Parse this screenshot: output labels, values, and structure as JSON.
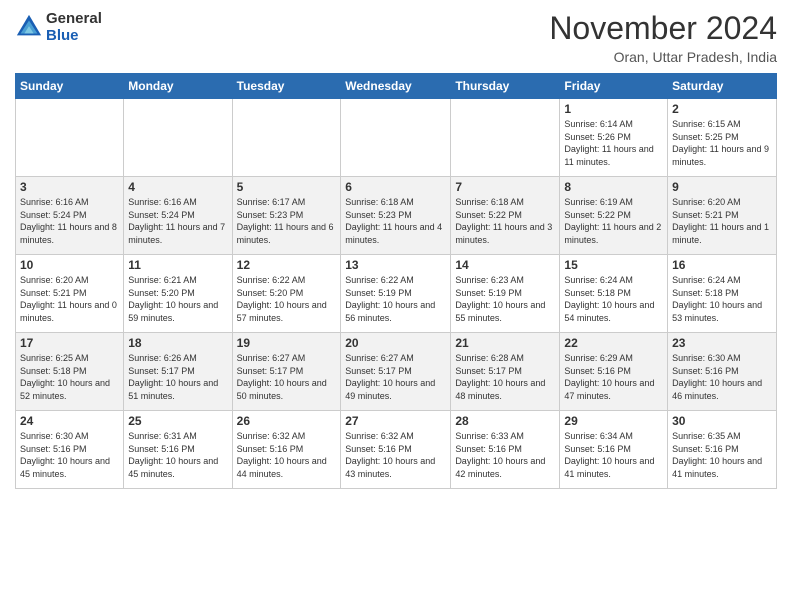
{
  "header": {
    "logo_general": "General",
    "logo_blue": "Blue",
    "month_title": "November 2024",
    "location": "Oran, Uttar Pradesh, India"
  },
  "calendar": {
    "days_of_week": [
      "Sunday",
      "Monday",
      "Tuesday",
      "Wednesday",
      "Thursday",
      "Friday",
      "Saturday"
    ],
    "weeks": [
      [
        {
          "day": "",
          "info": ""
        },
        {
          "day": "",
          "info": ""
        },
        {
          "day": "",
          "info": ""
        },
        {
          "day": "",
          "info": ""
        },
        {
          "day": "",
          "info": ""
        },
        {
          "day": "1",
          "info": "Sunrise: 6:14 AM\nSunset: 5:26 PM\nDaylight: 11 hours and 11 minutes."
        },
        {
          "day": "2",
          "info": "Sunrise: 6:15 AM\nSunset: 5:25 PM\nDaylight: 11 hours and 9 minutes."
        }
      ],
      [
        {
          "day": "3",
          "info": "Sunrise: 6:16 AM\nSunset: 5:24 PM\nDaylight: 11 hours and 8 minutes."
        },
        {
          "day": "4",
          "info": "Sunrise: 6:16 AM\nSunset: 5:24 PM\nDaylight: 11 hours and 7 minutes."
        },
        {
          "day": "5",
          "info": "Sunrise: 6:17 AM\nSunset: 5:23 PM\nDaylight: 11 hours and 6 minutes."
        },
        {
          "day": "6",
          "info": "Sunrise: 6:18 AM\nSunset: 5:23 PM\nDaylight: 11 hours and 4 minutes."
        },
        {
          "day": "7",
          "info": "Sunrise: 6:18 AM\nSunset: 5:22 PM\nDaylight: 11 hours and 3 minutes."
        },
        {
          "day": "8",
          "info": "Sunrise: 6:19 AM\nSunset: 5:22 PM\nDaylight: 11 hours and 2 minutes."
        },
        {
          "day": "9",
          "info": "Sunrise: 6:20 AM\nSunset: 5:21 PM\nDaylight: 11 hours and 1 minute."
        }
      ],
      [
        {
          "day": "10",
          "info": "Sunrise: 6:20 AM\nSunset: 5:21 PM\nDaylight: 11 hours and 0 minutes."
        },
        {
          "day": "11",
          "info": "Sunrise: 6:21 AM\nSunset: 5:20 PM\nDaylight: 10 hours and 59 minutes."
        },
        {
          "day": "12",
          "info": "Sunrise: 6:22 AM\nSunset: 5:20 PM\nDaylight: 10 hours and 57 minutes."
        },
        {
          "day": "13",
          "info": "Sunrise: 6:22 AM\nSunset: 5:19 PM\nDaylight: 10 hours and 56 minutes."
        },
        {
          "day": "14",
          "info": "Sunrise: 6:23 AM\nSunset: 5:19 PM\nDaylight: 10 hours and 55 minutes."
        },
        {
          "day": "15",
          "info": "Sunrise: 6:24 AM\nSunset: 5:18 PM\nDaylight: 10 hours and 54 minutes."
        },
        {
          "day": "16",
          "info": "Sunrise: 6:24 AM\nSunset: 5:18 PM\nDaylight: 10 hours and 53 minutes."
        }
      ],
      [
        {
          "day": "17",
          "info": "Sunrise: 6:25 AM\nSunset: 5:18 PM\nDaylight: 10 hours and 52 minutes."
        },
        {
          "day": "18",
          "info": "Sunrise: 6:26 AM\nSunset: 5:17 PM\nDaylight: 10 hours and 51 minutes."
        },
        {
          "day": "19",
          "info": "Sunrise: 6:27 AM\nSunset: 5:17 PM\nDaylight: 10 hours and 50 minutes."
        },
        {
          "day": "20",
          "info": "Sunrise: 6:27 AM\nSunset: 5:17 PM\nDaylight: 10 hours and 49 minutes."
        },
        {
          "day": "21",
          "info": "Sunrise: 6:28 AM\nSunset: 5:17 PM\nDaylight: 10 hours and 48 minutes."
        },
        {
          "day": "22",
          "info": "Sunrise: 6:29 AM\nSunset: 5:16 PM\nDaylight: 10 hours and 47 minutes."
        },
        {
          "day": "23",
          "info": "Sunrise: 6:30 AM\nSunset: 5:16 PM\nDaylight: 10 hours and 46 minutes."
        }
      ],
      [
        {
          "day": "24",
          "info": "Sunrise: 6:30 AM\nSunset: 5:16 PM\nDaylight: 10 hours and 45 minutes."
        },
        {
          "day": "25",
          "info": "Sunrise: 6:31 AM\nSunset: 5:16 PM\nDaylight: 10 hours and 45 minutes."
        },
        {
          "day": "26",
          "info": "Sunrise: 6:32 AM\nSunset: 5:16 PM\nDaylight: 10 hours and 44 minutes."
        },
        {
          "day": "27",
          "info": "Sunrise: 6:32 AM\nSunset: 5:16 PM\nDaylight: 10 hours and 43 minutes."
        },
        {
          "day": "28",
          "info": "Sunrise: 6:33 AM\nSunset: 5:16 PM\nDaylight: 10 hours and 42 minutes."
        },
        {
          "day": "29",
          "info": "Sunrise: 6:34 AM\nSunset: 5:16 PM\nDaylight: 10 hours and 41 minutes."
        },
        {
          "day": "30",
          "info": "Sunrise: 6:35 AM\nSunset: 5:16 PM\nDaylight: 10 hours and 41 minutes."
        }
      ]
    ]
  }
}
